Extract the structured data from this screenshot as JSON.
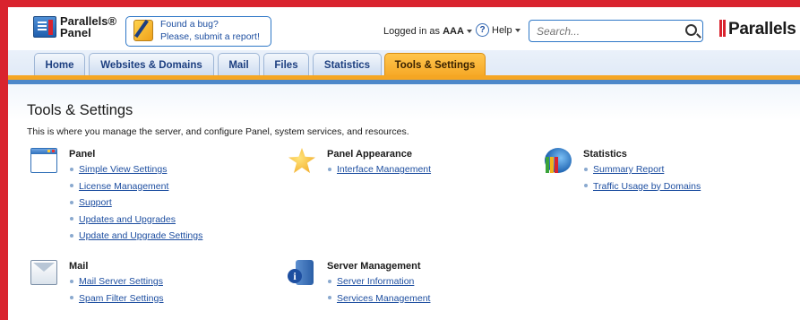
{
  "header": {
    "logo_line1": "Parallels®",
    "logo_line2": "Panel",
    "bug_line1": "Found a bug?",
    "bug_line2": "Please, submit a report!",
    "logged_in_prefix": "Logged in as",
    "username": "AAA",
    "help_label": "Help",
    "search_placeholder": "Search...",
    "brand": "Parallels"
  },
  "tabs": [
    {
      "label": "Home",
      "active": false
    },
    {
      "label": "Websites & Domains",
      "active": false
    },
    {
      "label": "Mail",
      "active": false
    },
    {
      "label": "Files",
      "active": false
    },
    {
      "label": "Statistics",
      "active": false
    },
    {
      "label": "Tools & Settings",
      "active": true
    }
  ],
  "page": {
    "title": "Tools & Settings",
    "description": "This is where you manage the server, and configure Panel, system services, and resources."
  },
  "groups": {
    "panel": {
      "title": "Panel",
      "icon": "panel-icon",
      "links": [
        "Simple View Settings",
        "License Management",
        "Support",
        "Updates and Upgrades",
        "Update and Upgrade Settings"
      ]
    },
    "appearance": {
      "title": "Panel Appearance",
      "icon": "appearance-icon",
      "links": [
        "Interface Management"
      ]
    },
    "statistics": {
      "title": "Statistics",
      "icon": "statistics-icon",
      "links": [
        "Summary Report",
        "Traffic Usage by Domains"
      ]
    },
    "mail": {
      "title": "Mail",
      "icon": "mail-icon",
      "links": [
        "Mail Server Settings",
        "Spam Filter Settings"
      ]
    },
    "server": {
      "title": "Server Management",
      "icon": "server-icon",
      "links": [
        "Server Information",
        "Services Management"
      ]
    }
  },
  "colors": {
    "frame_border": "#d9232e",
    "active_tab": "#f5a623",
    "link": "#1d4ea0",
    "nav_blue": "#4c87c9"
  }
}
